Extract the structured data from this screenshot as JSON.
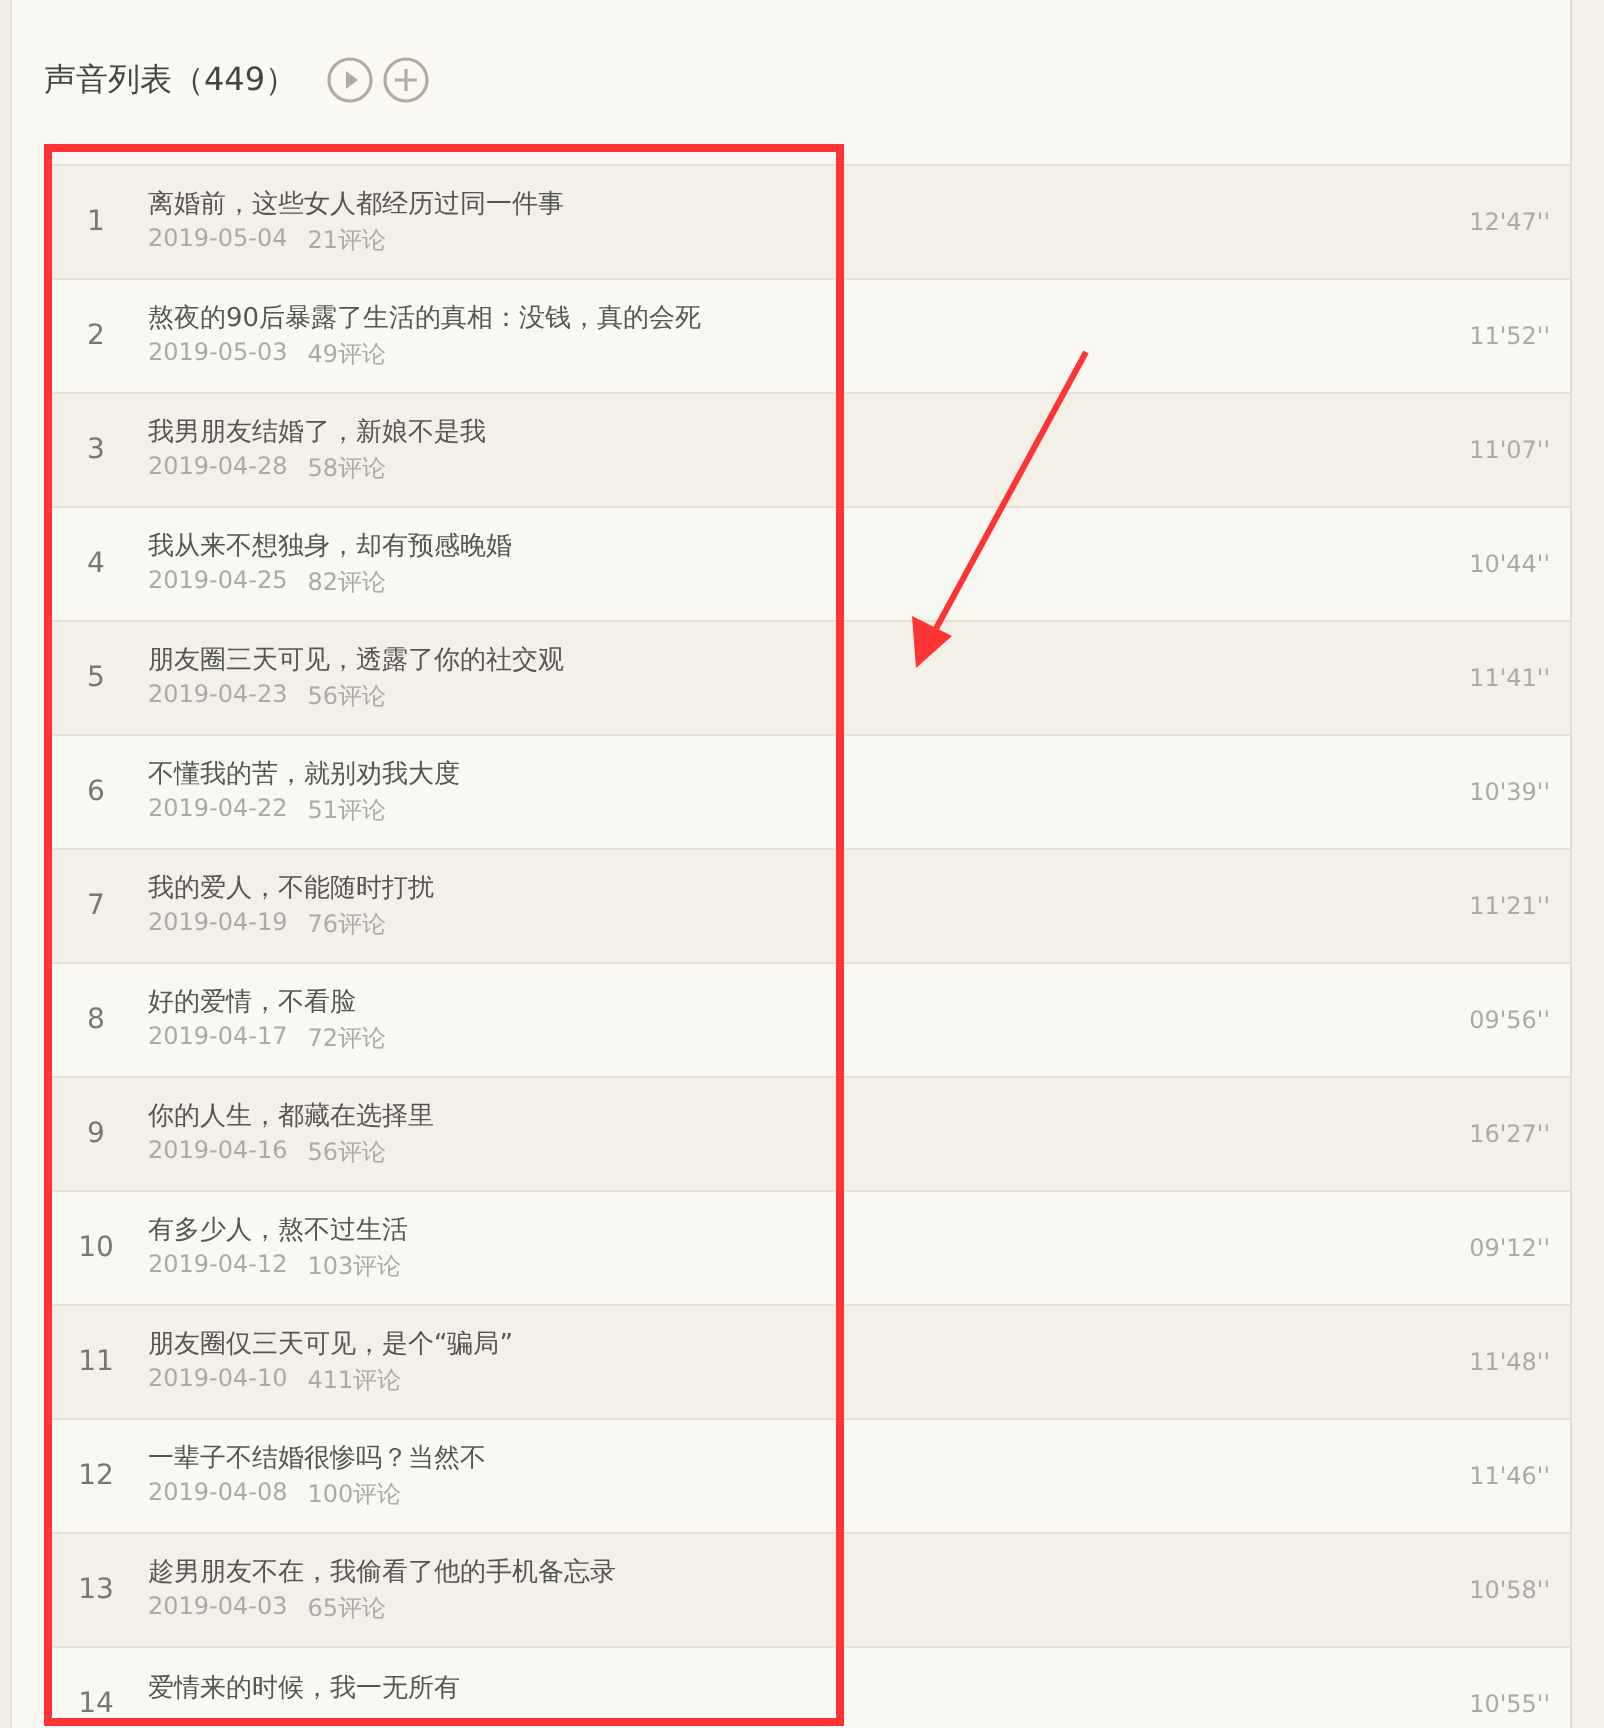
{
  "header": {
    "title": "声音列表（449）"
  },
  "tracks": [
    {
      "index": "1",
      "title": "离婚前，这些女人都经历过同一件事",
      "date": "2019-05-04",
      "comments": "21评论",
      "duration": "12'47''"
    },
    {
      "index": "2",
      "title": "熬夜的90后暴露了生活的真相：没钱，真的会死",
      "date": "2019-05-03",
      "comments": "49评论",
      "duration": "11'52''"
    },
    {
      "index": "3",
      "title": "我男朋友结婚了，新娘不是我",
      "date": "2019-04-28",
      "comments": "58评论",
      "duration": "11'07''"
    },
    {
      "index": "4",
      "title": "我从来不想独身，却有预感晚婚",
      "date": "2019-04-25",
      "comments": "82评论",
      "duration": "10'44''"
    },
    {
      "index": "5",
      "title": "朋友圈三天可见，透露了你的社交观",
      "date": "2019-04-23",
      "comments": "56评论",
      "duration": "11'41''"
    },
    {
      "index": "6",
      "title": "不懂我的苦，就别劝我大度",
      "date": "2019-04-22",
      "comments": "51评论",
      "duration": "10'39''"
    },
    {
      "index": "7",
      "title": "我的爱人，不能随时打扰",
      "date": "2019-04-19",
      "comments": "76评论",
      "duration": "11'21''"
    },
    {
      "index": "8",
      "title": "好的爱情，不看脸",
      "date": "2019-04-17",
      "comments": "72评论",
      "duration": "09'56''"
    },
    {
      "index": "9",
      "title": "你的人生，都藏在选择里",
      "date": "2019-04-16",
      "comments": "56评论",
      "duration": "16'27''"
    },
    {
      "index": "10",
      "title": "有多少人，熬不过生活",
      "date": "2019-04-12",
      "comments": "103评论",
      "duration": "09'12''"
    },
    {
      "index": "11",
      "title": "朋友圈仅三天可见，是个“骗局”",
      "date": "2019-04-10",
      "comments": "411评论",
      "duration": "11'48''"
    },
    {
      "index": "12",
      "title": "一辈子不结婚很惨吗？当然不",
      "date": "2019-04-08",
      "comments": "100评论",
      "duration": "11'46''"
    },
    {
      "index": "13",
      "title": "趁男朋友不在，我偷看了他的手机备忘录",
      "date": "2019-04-03",
      "comments": "65评论",
      "duration": "10'58''"
    },
    {
      "index": "14",
      "title": "爱情来的时候，我一无所有",
      "duration": "10'55''"
    }
  ]
}
